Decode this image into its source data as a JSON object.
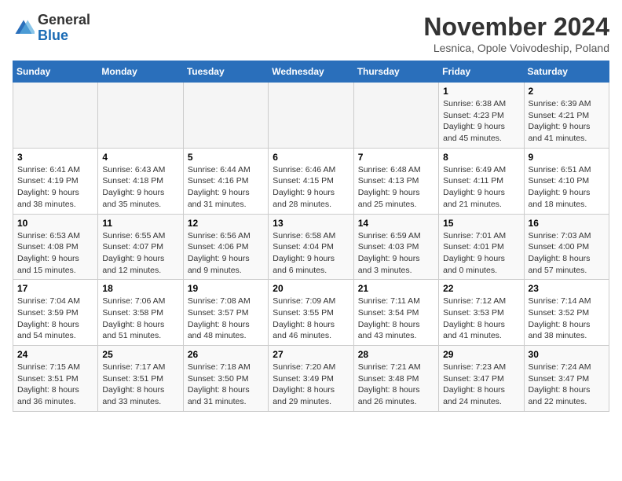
{
  "logo": {
    "general": "General",
    "blue": "Blue"
  },
  "title": "November 2024",
  "subtitle": "Lesnica, Opole Voivodeship, Poland",
  "weekdays": [
    "Sunday",
    "Monday",
    "Tuesday",
    "Wednesday",
    "Thursday",
    "Friday",
    "Saturday"
  ],
  "weeks": [
    [
      {
        "day": "",
        "info": ""
      },
      {
        "day": "",
        "info": ""
      },
      {
        "day": "",
        "info": ""
      },
      {
        "day": "",
        "info": ""
      },
      {
        "day": "",
        "info": ""
      },
      {
        "day": "1",
        "info": "Sunrise: 6:38 AM\nSunset: 4:23 PM\nDaylight: 9 hours\nand 45 minutes."
      },
      {
        "day": "2",
        "info": "Sunrise: 6:39 AM\nSunset: 4:21 PM\nDaylight: 9 hours\nand 41 minutes."
      }
    ],
    [
      {
        "day": "3",
        "info": "Sunrise: 6:41 AM\nSunset: 4:19 PM\nDaylight: 9 hours\nand 38 minutes."
      },
      {
        "day": "4",
        "info": "Sunrise: 6:43 AM\nSunset: 4:18 PM\nDaylight: 9 hours\nand 35 minutes."
      },
      {
        "day": "5",
        "info": "Sunrise: 6:44 AM\nSunset: 4:16 PM\nDaylight: 9 hours\nand 31 minutes."
      },
      {
        "day": "6",
        "info": "Sunrise: 6:46 AM\nSunset: 4:15 PM\nDaylight: 9 hours\nand 28 minutes."
      },
      {
        "day": "7",
        "info": "Sunrise: 6:48 AM\nSunset: 4:13 PM\nDaylight: 9 hours\nand 25 minutes."
      },
      {
        "day": "8",
        "info": "Sunrise: 6:49 AM\nSunset: 4:11 PM\nDaylight: 9 hours\nand 21 minutes."
      },
      {
        "day": "9",
        "info": "Sunrise: 6:51 AM\nSunset: 4:10 PM\nDaylight: 9 hours\nand 18 minutes."
      }
    ],
    [
      {
        "day": "10",
        "info": "Sunrise: 6:53 AM\nSunset: 4:08 PM\nDaylight: 9 hours\nand 15 minutes."
      },
      {
        "day": "11",
        "info": "Sunrise: 6:55 AM\nSunset: 4:07 PM\nDaylight: 9 hours\nand 12 minutes."
      },
      {
        "day": "12",
        "info": "Sunrise: 6:56 AM\nSunset: 4:06 PM\nDaylight: 9 hours\nand 9 minutes."
      },
      {
        "day": "13",
        "info": "Sunrise: 6:58 AM\nSunset: 4:04 PM\nDaylight: 9 hours\nand 6 minutes."
      },
      {
        "day": "14",
        "info": "Sunrise: 6:59 AM\nSunset: 4:03 PM\nDaylight: 9 hours\nand 3 minutes."
      },
      {
        "day": "15",
        "info": "Sunrise: 7:01 AM\nSunset: 4:01 PM\nDaylight: 9 hours\nand 0 minutes."
      },
      {
        "day": "16",
        "info": "Sunrise: 7:03 AM\nSunset: 4:00 PM\nDaylight: 8 hours\nand 57 minutes."
      }
    ],
    [
      {
        "day": "17",
        "info": "Sunrise: 7:04 AM\nSunset: 3:59 PM\nDaylight: 8 hours\nand 54 minutes."
      },
      {
        "day": "18",
        "info": "Sunrise: 7:06 AM\nSunset: 3:58 PM\nDaylight: 8 hours\nand 51 minutes."
      },
      {
        "day": "19",
        "info": "Sunrise: 7:08 AM\nSunset: 3:57 PM\nDaylight: 8 hours\nand 48 minutes."
      },
      {
        "day": "20",
        "info": "Sunrise: 7:09 AM\nSunset: 3:55 PM\nDaylight: 8 hours\nand 46 minutes."
      },
      {
        "day": "21",
        "info": "Sunrise: 7:11 AM\nSunset: 3:54 PM\nDaylight: 8 hours\nand 43 minutes."
      },
      {
        "day": "22",
        "info": "Sunrise: 7:12 AM\nSunset: 3:53 PM\nDaylight: 8 hours\nand 41 minutes."
      },
      {
        "day": "23",
        "info": "Sunrise: 7:14 AM\nSunset: 3:52 PM\nDaylight: 8 hours\nand 38 minutes."
      }
    ],
    [
      {
        "day": "24",
        "info": "Sunrise: 7:15 AM\nSunset: 3:51 PM\nDaylight: 8 hours\nand 36 minutes."
      },
      {
        "day": "25",
        "info": "Sunrise: 7:17 AM\nSunset: 3:51 PM\nDaylight: 8 hours\nand 33 minutes."
      },
      {
        "day": "26",
        "info": "Sunrise: 7:18 AM\nSunset: 3:50 PM\nDaylight: 8 hours\nand 31 minutes."
      },
      {
        "day": "27",
        "info": "Sunrise: 7:20 AM\nSunset: 3:49 PM\nDaylight: 8 hours\nand 29 minutes."
      },
      {
        "day": "28",
        "info": "Sunrise: 7:21 AM\nSunset: 3:48 PM\nDaylight: 8 hours\nand 26 minutes."
      },
      {
        "day": "29",
        "info": "Sunrise: 7:23 AM\nSunset: 3:47 PM\nDaylight: 8 hours\nand 24 minutes."
      },
      {
        "day": "30",
        "info": "Sunrise: 7:24 AM\nSunset: 3:47 PM\nDaylight: 8 hours\nand 22 minutes."
      }
    ]
  ]
}
